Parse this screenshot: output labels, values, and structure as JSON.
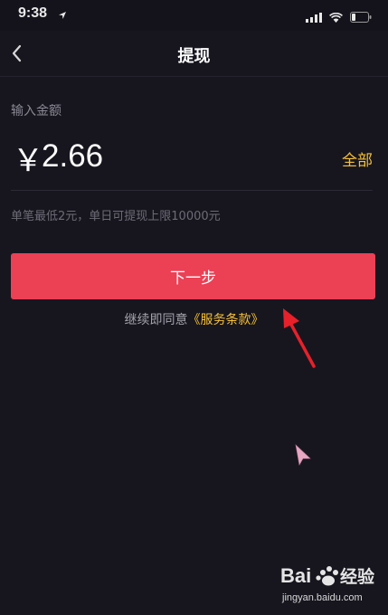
{
  "status_bar": {
    "time": "9:38"
  },
  "nav": {
    "title": "提现"
  },
  "form": {
    "amount_label": "输入金额",
    "currency_symbol": "￥",
    "amount_value": "2.66",
    "all_label": "全部",
    "limit_note": "单笔最低2元，单日可提现上限10000元"
  },
  "actions": {
    "next_label": "下一步",
    "terms_prefix": "继续即同意",
    "terms_link": "《服务条款》"
  },
  "watermark": {
    "logo_text": "Bai 经验",
    "url": "jingyan.baidu.com"
  },
  "colors": {
    "background": "#17161f",
    "accent_red": "#ec4055",
    "accent_yellow": "#f6c135"
  }
}
